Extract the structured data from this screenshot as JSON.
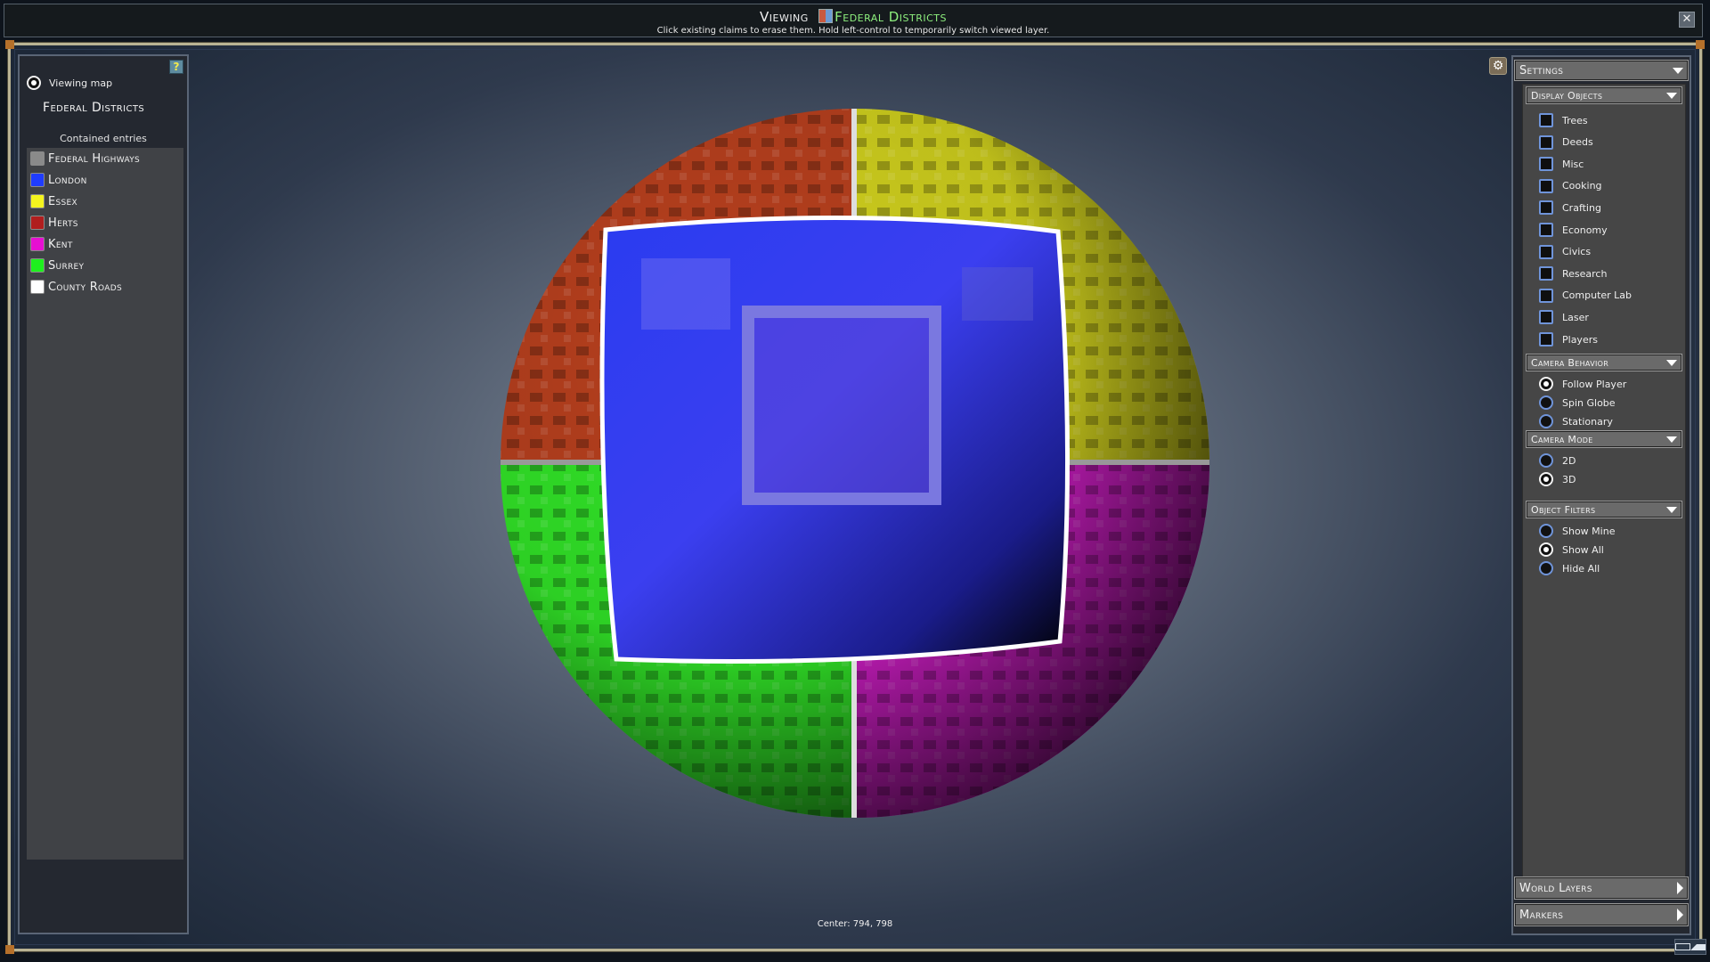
{
  "header": {
    "viewing_prefix": "Viewing",
    "layer_name": "Federal Districts",
    "layer_icon": "layer-map-icon",
    "instructions": "Click existing claims to erase them. Hold left-control to temporarily switch viewed layer.",
    "close_icon": "✕"
  },
  "left_panel": {
    "help_label": "?",
    "viewing_map_label": "Viewing map",
    "viewing_map_selected": true,
    "map_name": "Federal Districts",
    "entries_title": "Contained entries",
    "entries": [
      {
        "label": "Federal Highways",
        "color": "#8a8a8a"
      },
      {
        "label": "London",
        "color": "#1f3cff"
      },
      {
        "label": "Essex",
        "color": "#f4f41e"
      },
      {
        "label": "Herts",
        "color": "#b01e1e"
      },
      {
        "label": "Kent",
        "color": "#e60fd2"
      },
      {
        "label": "Surrey",
        "color": "#1ef01e"
      },
      {
        "label": "County Roads",
        "color": "#ffffff"
      }
    ]
  },
  "viewport": {
    "center_label": "Center: 794, 798",
    "regions": [
      {
        "name": "Herts",
        "color": "#b8401e"
      },
      {
        "name": "Essex",
        "color": "#d2d21e"
      },
      {
        "name": "London",
        "color": "#2a3cf0"
      },
      {
        "name": "Surrey",
        "color": "#32e628"
      },
      {
        "name": "Kent",
        "color": "#d21ec8"
      }
    ]
  },
  "right_panel": {
    "gear_icon": "⚙",
    "settings_label": "Settings",
    "display_objects": {
      "label": "Display Objects",
      "items": [
        {
          "label": "Trees",
          "checked": false
        },
        {
          "label": "Deeds",
          "checked": false
        },
        {
          "label": "Misc",
          "checked": false
        },
        {
          "label": "Cooking",
          "checked": false
        },
        {
          "label": "Crafting",
          "checked": false
        },
        {
          "label": "Economy",
          "checked": false
        },
        {
          "label": "Civics",
          "checked": false
        },
        {
          "label": "Research",
          "checked": false
        },
        {
          "label": "Computer Lab",
          "checked": false
        },
        {
          "label": "Laser",
          "checked": false
        },
        {
          "label": "Players",
          "checked": false
        }
      ]
    },
    "camera_behavior": {
      "label": "Camera Behavior",
      "options": [
        {
          "label": "Follow Player",
          "selected": true
        },
        {
          "label": "Spin Globe",
          "selected": false
        },
        {
          "label": "Stationary",
          "selected": false
        }
      ]
    },
    "camera_mode": {
      "label": "Camera Mode",
      "options": [
        {
          "label": "2D",
          "selected": false
        },
        {
          "label": "3D",
          "selected": true
        }
      ]
    },
    "object_filters": {
      "label": "Object Filters",
      "options": [
        {
          "label": "Show Mine",
          "selected": false
        },
        {
          "label": "Show All",
          "selected": true
        },
        {
          "label": "Hide All",
          "selected": false
        }
      ]
    },
    "world_layers_label": "World Layers",
    "markers_label": "Markers"
  }
}
